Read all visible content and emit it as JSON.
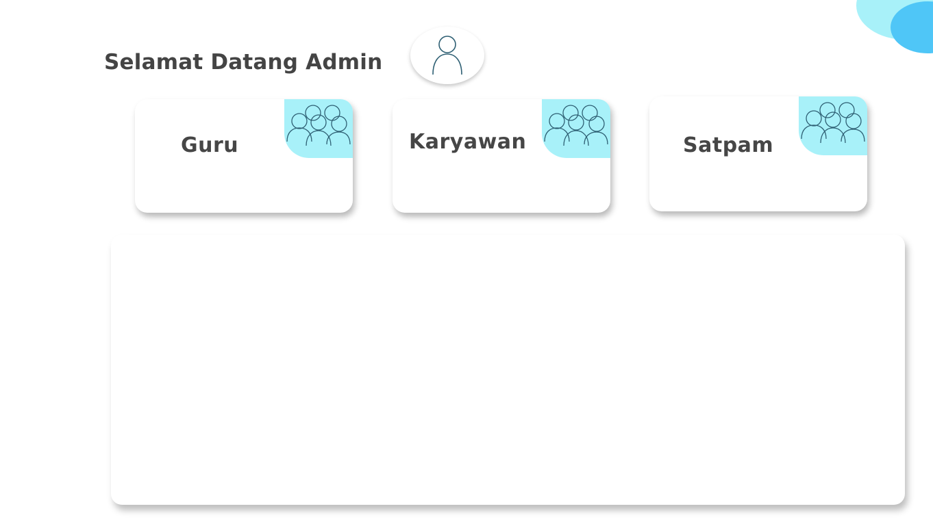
{
  "header": {
    "welcome_text": "Selamat Datang Admin",
    "avatar_icon": "user-icon"
  },
  "cards": [
    {
      "label": "Guru",
      "icon": "group-icon"
    },
    {
      "label": "Karyawan",
      "icon": "group-icon"
    },
    {
      "label": "Satpam",
      "icon": "group-icon"
    }
  ],
  "colors": {
    "accent_cyan": "#a8f1f9",
    "accent_blue": "#4fc6f7",
    "text": "#444444"
  }
}
